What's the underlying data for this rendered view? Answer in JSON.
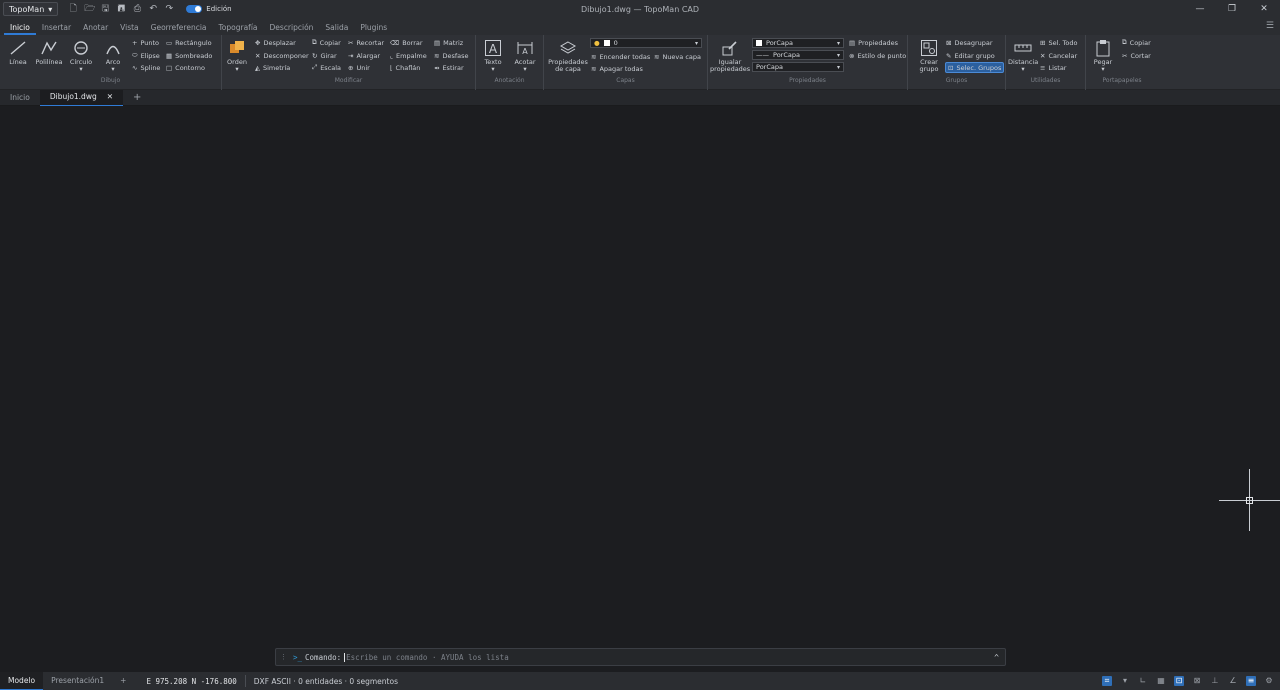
{
  "titlebar": {
    "app_menu": "TopoMan",
    "edit_toggle_label": "Edición",
    "window_title": "Dibujo1.dwg — TopoMan CAD"
  },
  "ribbon_tabs": [
    "Inicio",
    "Insertar",
    "Anotar",
    "Vista",
    "Georreferencia",
    "Topografía",
    "Descripción",
    "Salida",
    "Plugins"
  ],
  "ribbon": {
    "dibujo": {
      "label": "Dibujo",
      "linea": "Línea",
      "polilinea": "Polilínea",
      "circulo": "Círculo",
      "arco": "Arco",
      "punto": "Punto",
      "elipse": "Elipse",
      "spline": "Spline",
      "rectangulo": "Rectángulo",
      "sombreado": "Sombreado",
      "contorno": "Contorno"
    },
    "modificar": {
      "label": "Modificar",
      "orden": "Orden",
      "desplazar": "Desplazar",
      "descomponer": "Descomponer",
      "simetria": "Simetría",
      "copiar": "Copiar",
      "girar": "Girar",
      "escala": "Escala",
      "recortar": "Recortar",
      "alargar": "Alargar",
      "unir": "Unir",
      "borrar": "Borrar",
      "empalme": "Empalme",
      "chaflan": "Chaflán",
      "matriz": "Matriz",
      "desfase": "Desfase",
      "estirar": "Estirar"
    },
    "anotacion": {
      "label": "Anotación",
      "texto": "Texto",
      "acotar": "Acotar"
    },
    "capas": {
      "label": "Capas",
      "propiedades_capa": "Propiedades de capa",
      "layer_value": "0",
      "encender": "Encender todas",
      "apagar": "Apagar todas",
      "nueva": "Nueva capa"
    },
    "propiedades": {
      "label": "Propiedades",
      "igualar": "Igualar propiedades",
      "color": "PorCapa",
      "linetype": "PorCapa",
      "lineweight": "PorCapa",
      "propiedades": "Propiedades",
      "estilo_punto": "Estilo de punto"
    },
    "grupos": {
      "label": "Grupos",
      "crear": "Crear grupo",
      "desagrupar": "Desagrupar",
      "editar": "Editar grupo",
      "selec": "Selec. Grupos"
    },
    "utilidades": {
      "label": "Utilidades",
      "distancia": "Distancia",
      "sel_todo": "Sel. Todo",
      "cancelar": "Cancelar",
      "listar": "Listar"
    },
    "portapapeles": {
      "label": "Portapapeles",
      "pegar": "Pegar",
      "copiar": "Copiar",
      "cortar": "Cortar"
    }
  },
  "doc_tabs": {
    "home": "Inicio",
    "active": "Dibujo1.dwg"
  },
  "command": {
    "label": "Comando:",
    "placeholder": "Escribe un comando · AYUDA los lista"
  },
  "status": {
    "model_tab": "Modelo",
    "layout_tab": "Presentación1",
    "coords": "E 975.208  N -176.800",
    "file_info": "DXF ASCII · 0 entidades · 0 segmentos"
  }
}
